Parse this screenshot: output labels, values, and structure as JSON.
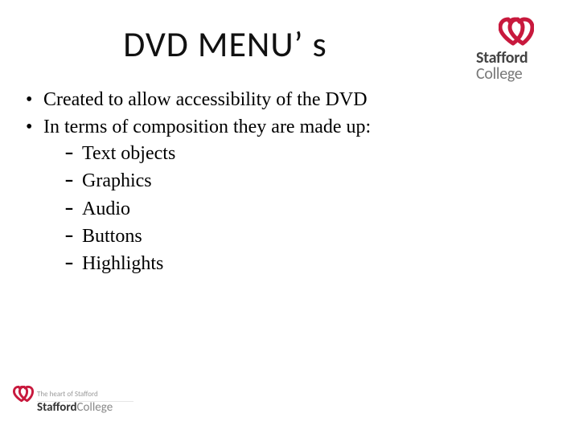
{
  "title": "DVD MENU’ s",
  "bullets": [
    {
      "text": "Created to allow accessibility of the DVD"
    },
    {
      "text": "In terms of composition they are made up:"
    }
  ],
  "sub_bullets": [
    {
      "text": "Text objects"
    },
    {
      "text": "Graphics"
    },
    {
      "text": "Audio"
    },
    {
      "text": "Buttons"
    },
    {
      "text": "Highlights"
    }
  ],
  "logo": {
    "word1": "Stafford",
    "word2": "College",
    "tagline": "The heart of Stafford",
    "footer_bold": "Stafford",
    "footer_light": "College",
    "color": "#c8193d"
  }
}
